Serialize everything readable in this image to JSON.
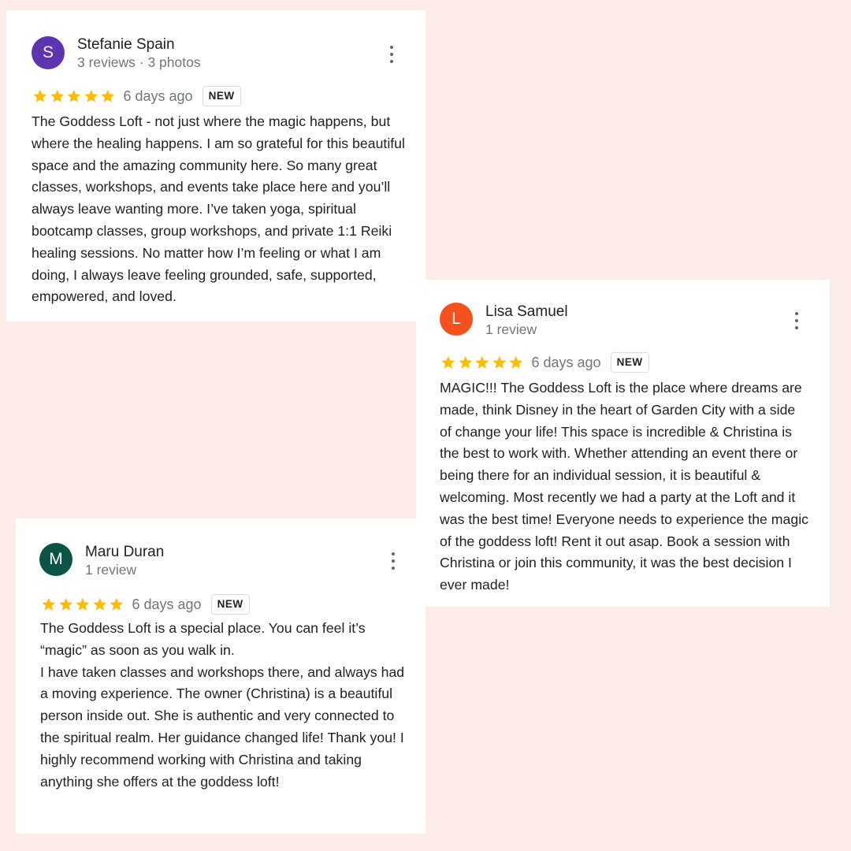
{
  "colors": {
    "background": "#fcece8",
    "star": "#fbbc04"
  },
  "reviews": [
    {
      "initial": "S",
      "avatar_color": "#5e35b1",
      "name": "Stefanie Spain",
      "meta": "3 reviews · 3 photos",
      "rating": 5,
      "time": "6 days ago",
      "badge": "NEW",
      "icons": {
        "menu": "more-vert-icon",
        "star": "star-icon"
      },
      "text": "The Goddess Loft - not just where the magic happens, but where the healing happens. I am so grateful for this beautiful space and the amazing community here. So many great classes, workshops, and events take place here and you’ll always leave wanting more.  I’ve taken yoga, spiritual bootcamp classes, group workshops, and private 1:1 Reiki healing sessions. No matter how I’m feeling or what I am doing, I always leave feeling grounded, safe, supported, empowered, and loved."
    },
    {
      "initial": "L",
      "avatar_color": "#f4511e",
      "name": "Lisa Samuel",
      "meta": "1 review",
      "rating": 5,
      "time": "6 days ago",
      "badge": "NEW",
      "icons": {
        "menu": "more-vert-icon",
        "star": "star-icon"
      },
      "text": "MAGIC!!! The Goddess Loft is the place where dreams are made, think Disney in the heart of Garden City with a side of change your life! This space is incredible & Christina is the best to work with. Whether attending an event there or being there for an individual session, it is beautiful & welcoming. Most recently we had a party at the Loft and it was the best time! Everyone needs to experience the magic of the goddess loft! Rent it out asap. Book a session with Christina or join this community, it was the best decision I ever made!"
    },
    {
      "initial": "M",
      "avatar_color": "#0b5345",
      "name": "Maru Duran",
      "meta": "1 review",
      "rating": 5,
      "time": "6 days ago",
      "badge": "NEW",
      "icons": {
        "menu": "more-vert-icon",
        "star": "star-icon"
      },
      "text": "The Goddess Loft is a special place. You can feel it’s “magic” as soon as you walk in.\nI have taken classes and workshops there, and always had a moving experience. The owner (Christina) is a beautiful person inside out. She is authentic and very connected to the spiritual realm. Her guidance changed life! Thank you! I highly recommend working with Christina and taking anything she offers at the goddess loft!"
    }
  ]
}
